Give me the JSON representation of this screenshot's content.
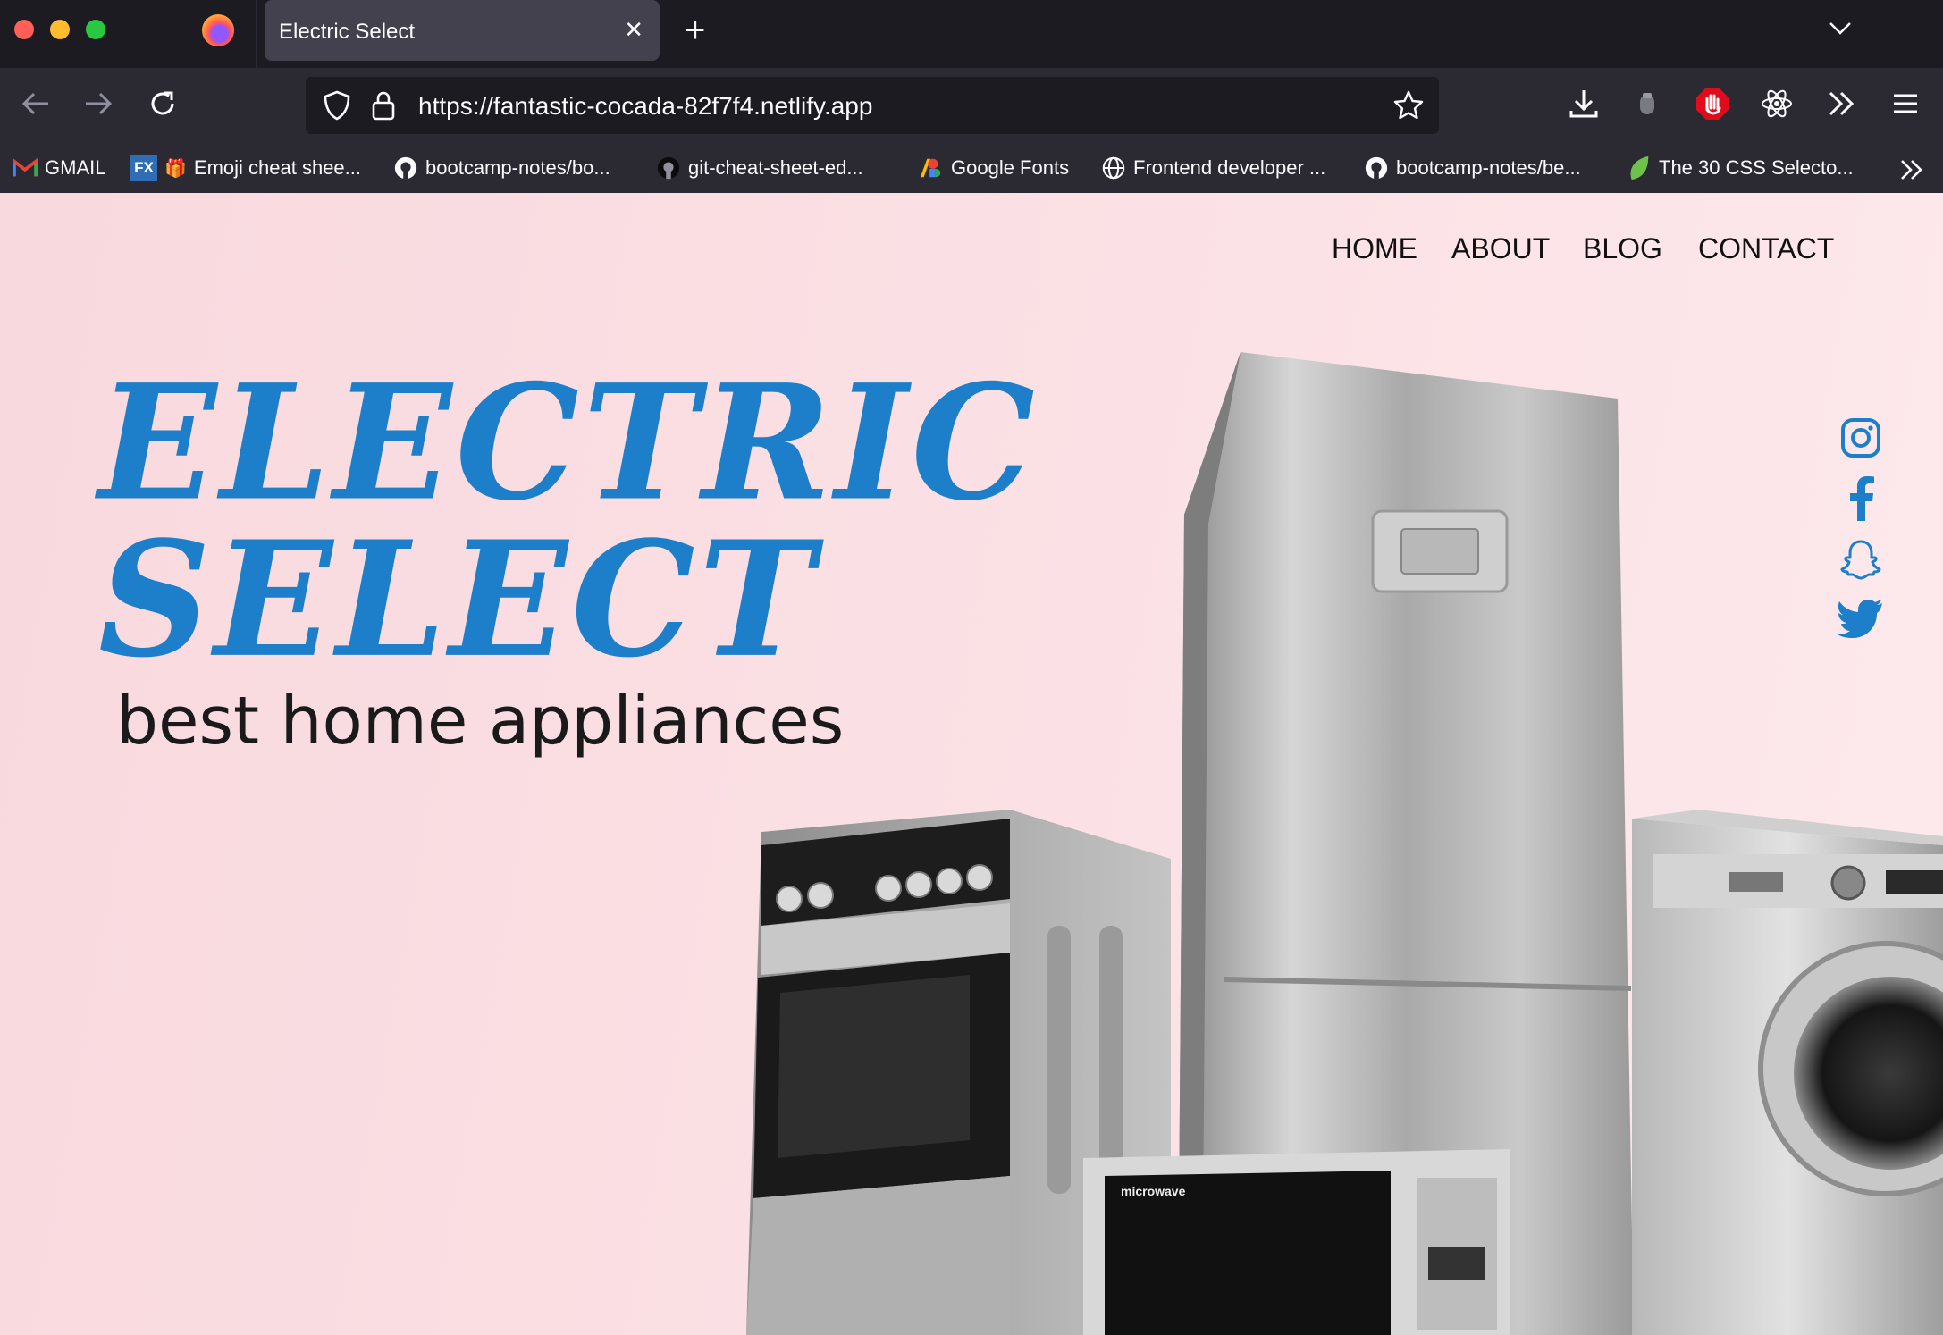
{
  "browser": {
    "tab_title": "Electric Select",
    "url": "https://fantastic-cocada-82f7f4.netlify.app",
    "bookmarks": [
      {
        "label": "GMAIL",
        "icon": "gmail-icon"
      },
      {
        "label": "Emoji cheat shee...",
        "icon": "fx-icon"
      },
      {
        "label": "bootcamp-notes/bo...",
        "icon": "github-icon"
      },
      {
        "label": "git-cheat-sheet-ed...",
        "icon": "github-icon"
      },
      {
        "label": "Google Fonts",
        "icon": "google-fonts-icon"
      },
      {
        "label": "Frontend developer ...",
        "icon": "globe-icon"
      },
      {
        "label": "bootcamp-notes/be...",
        "icon": "github-icon"
      },
      {
        "label": "The 30 CSS Selecto...",
        "icon": "leaf-icon"
      }
    ]
  },
  "site": {
    "nav": [
      "HOME",
      "ABOUT",
      "BLOG",
      "CONTACT"
    ],
    "title_line1": "ELECTRIC",
    "title_line2": "SELECT",
    "tagline": "best home appliances",
    "social": [
      "instagram-icon",
      "facebook-icon",
      "snapchat-icon",
      "twitter-icon"
    ],
    "microwave_label": "microwave",
    "brand_color": "#1d7fc9"
  }
}
